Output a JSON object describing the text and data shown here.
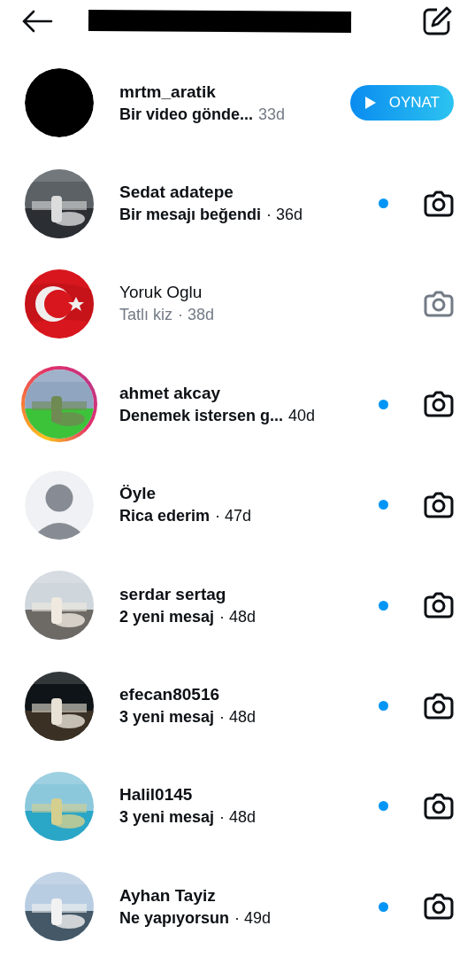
{
  "header": {
    "title_redacted": true
  },
  "conversations": [
    {
      "name": "mrtm_aratik",
      "message": "Bir video gönde...",
      "time": "33d",
      "unread": true,
      "time_dimmed": true,
      "avatar": {
        "kind": "blank",
        "story": false
      },
      "action": {
        "kind": "play",
        "label": "OYNAT"
      }
    },
    {
      "name": "Sedat adatepe",
      "message": "Bir mesajı beğendi",
      "time": "· 36d",
      "unread": true,
      "time_dimmed": false,
      "avatar": {
        "kind": "picture",
        "story": false
      },
      "action": {
        "kind": "camera"
      }
    },
    {
      "name": "Yoruk Oglu",
      "message": "Tatlı kiz",
      "time": "· 38d",
      "unread": false,
      "time_dimmed": true,
      "avatar": {
        "kind": "picture",
        "story": false
      },
      "action": {
        "kind": "camera"
      }
    },
    {
      "name": "ahmet akcay",
      "message": "Denemek  istersen g...",
      "time": "40d",
      "unread": true,
      "time_dimmed": false,
      "avatar": {
        "kind": "picture",
        "story": true
      },
      "action": {
        "kind": "camera"
      }
    },
    {
      "name": "Öyle",
      "message": "Rica ederim",
      "time": "· 47d",
      "unread": true,
      "time_dimmed": false,
      "avatar": {
        "kind": "default",
        "story": false
      },
      "action": {
        "kind": "camera"
      }
    },
    {
      "name": "serdar sertag",
      "message": "2 yeni mesaj",
      "time": "· 48d",
      "unread": true,
      "time_dimmed": false,
      "avatar": {
        "kind": "picture",
        "story": false
      },
      "action": {
        "kind": "camera"
      }
    },
    {
      "name": "efecan80516",
      "message": "3 yeni mesaj",
      "time": "· 48d",
      "unread": true,
      "time_dimmed": false,
      "avatar": {
        "kind": "picture",
        "story": false
      },
      "action": {
        "kind": "camera"
      }
    },
    {
      "name": "Halil0145",
      "message": "3 yeni mesaj",
      "time": "· 48d",
      "unread": true,
      "time_dimmed": false,
      "avatar": {
        "kind": "picture",
        "story": false
      },
      "action": {
        "kind": "camera"
      }
    },
    {
      "name": "Ayhan Tayiz",
      "message": "Ne yapıyorsun",
      "time": "· 49d",
      "unread": true,
      "time_dimmed": false,
      "avatar": {
        "kind": "picture",
        "story": false
      },
      "action": {
        "kind": "camera"
      }
    }
  ]
}
